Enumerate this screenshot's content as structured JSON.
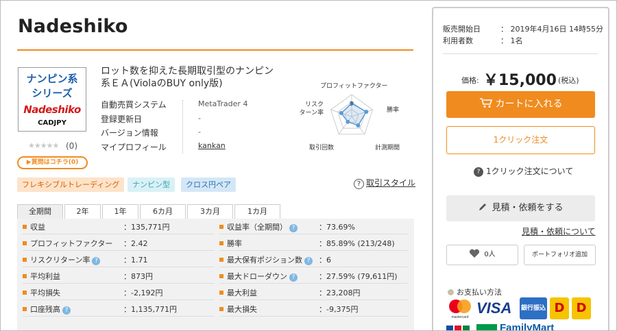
{
  "product": {
    "title": "Nadeshiko",
    "subtitle": "ロット数を抑えた長期取引型のナンピン系ＥＡ(ViolaのBUY only版)",
    "logo": {
      "line1": "ナンピン系",
      "line2": "シリーズ",
      "line3": "Nadeshiko",
      "line4": "CADJPY"
    },
    "stars": "★★★★★",
    "review_count": "(0)",
    "question_button": "質問はコチラ(0)",
    "info": [
      {
        "label": "自動売買システム",
        "value": "MetaTrader 4"
      },
      {
        "label": "登録更新日",
        "value": "-"
      },
      {
        "label": "バージョン情報",
        "value": "-"
      },
      {
        "label": "マイプロフィール",
        "value": "kankan"
      }
    ]
  },
  "radar": {
    "labels": [
      "プロフィットファクター",
      "勝率",
      "計測期間",
      "取引回数",
      "リスクターン率"
    ],
    "label_lines": {
      "risk1": "リスク",
      "risk2": "ターン率"
    },
    "center_label": "3",
    "values": [
      3,
      3.5,
      2.5,
      1.5,
      2.5
    ],
    "max": 5
  },
  "tags": [
    "フレキシブルトレーディング",
    "ナンピン型",
    "クロス円ペア"
  ],
  "style_link": {
    "q": "?",
    "label": "取引スタイル"
  },
  "tabs": [
    "全期間",
    "2年",
    "1年",
    "6カ月",
    "3カ月",
    "1カ月"
  ],
  "stats_left": [
    {
      "label": "収益",
      "value": "：135,771円",
      "help": false
    },
    {
      "label": "プロフィットファクター",
      "value": "：2.42",
      "help": false
    },
    {
      "label": "リスクリターン率",
      "value": "：1.71",
      "help": true
    },
    {
      "label": "平均利益",
      "value": "：873円",
      "help": false
    },
    {
      "label": "平均損失",
      "value": "：-2,192円",
      "help": false
    },
    {
      "label": "口座残高",
      "value": "：1,135,771円",
      "help": true
    }
  ],
  "stats_right": [
    {
      "label": "収益率（全期間）",
      "value": "：73.69%",
      "help": true
    },
    {
      "label": "勝率",
      "value": "：85.89% (213/248)",
      "help": false
    },
    {
      "label": "最大保有ポジション数",
      "value": "：6",
      "help": true
    },
    {
      "label": "最大ドローダウン",
      "value": "：27.59% (79,611円)",
      "help": true
    },
    {
      "label": "最大利益",
      "value": "：23,208円",
      "help": false
    },
    {
      "label": "最大損失",
      "value": "：-9,375円",
      "help": false
    }
  ],
  "help_glyph": "?",
  "sidebar": {
    "sale_start_label": "販売開始日",
    "sale_start_value": "：  2019年4月16日 14時55分",
    "users_label": "利用者数",
    "users_value": "：  1名",
    "price_label": "価格:",
    "price": "￥15,000",
    "tax": "(税込)",
    "cart_button": "カートに入れる",
    "oneclick_button": "1クリック注文",
    "oneclick_about": "1クリック注文について",
    "quote_button": "見積・依頼をする",
    "quote_about": "見積・依頼について",
    "favorites": "0人",
    "portfolio": "ポートフォリオ追加",
    "payment_title": "お支払い方法",
    "payment_methods": {
      "visa": "VISA",
      "bank": "銀行振込",
      "mc": "mastercard",
      "daily": "Daily"
    }
  },
  "colors": {
    "accent": "#f08b1f",
    "visa_blue": "#1a3b8e",
    "bank_blue": "#2d6fc4"
  }
}
